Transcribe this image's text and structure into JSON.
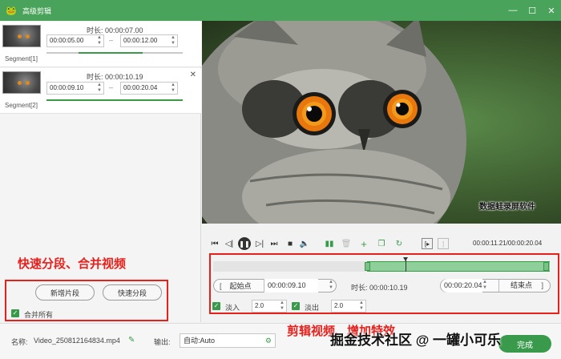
{
  "titlebar": {
    "title": "高级剪辑",
    "minimize": "—",
    "maximize": "☐",
    "close": "✕"
  },
  "segments": [
    {
      "label": "Segment[1]",
      "duration": "时长: 00:00:07.00",
      "start": "00:00:05.00",
      "end": "00:00:12.00",
      "progress": 0.45
    },
    {
      "label": "Segment[2]",
      "duration": "时长: 00:00:10.19",
      "start": "00:00:09.10",
      "end": "00:00:20.04",
      "progress": 0.95
    }
  ],
  "annotations": {
    "left": "快速分段、合并视频",
    "right": "剪辑视频、增加特效"
  },
  "left_buttons": {
    "new_segment": "新增片段",
    "quick_split": "快速分段",
    "merge_all": "合并所有"
  },
  "video": {
    "watermark": "数据蛙录屏软件"
  },
  "player": {
    "time_readout": "00:00:11.21/00:00:20.04"
  },
  "trim": {
    "start_label": "起始点",
    "start_time": "00:00:09.10",
    "duration": "时长: 00:00:10.19",
    "end_time": "00:00:20.04",
    "end_label": "结束点",
    "fade_in_label": "淡入",
    "fade_in_value": "2.0",
    "fade_out_label": "淡出",
    "fade_out_value": "2.0",
    "selection_start_fraction": 0.455,
    "playhead_fraction": 0.57
  },
  "footer": {
    "name_label": "名称:",
    "file_name": "Video_250812164834.mp4",
    "output_label": "输出:",
    "output_value": "自动:Auto",
    "watermark": "掘金技术社区 @ 一罐小可乐",
    "action_button": "完成"
  },
  "colors": {
    "accent": "#4aa35a",
    "annotation": "#e8201c",
    "track_selection": "#8fcf9a"
  }
}
